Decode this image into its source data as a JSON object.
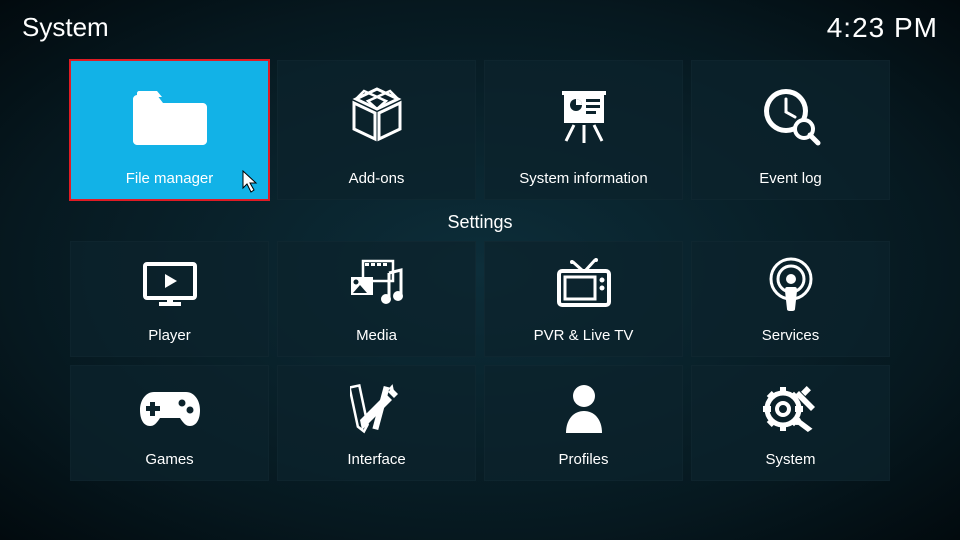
{
  "header": {
    "title": "System",
    "clock": "4:23 PM"
  },
  "section_header": "Settings",
  "row1": [
    {
      "label": "File manager",
      "icon": "folder",
      "selected": true
    },
    {
      "label": "Add-ons",
      "icon": "box"
    },
    {
      "label": "System information",
      "icon": "presentation"
    },
    {
      "label": "Event log",
      "icon": "clock-search"
    }
  ],
  "row2": [
    {
      "label": "Player",
      "icon": "monitor-play"
    },
    {
      "label": "Media",
      "icon": "media-mix"
    },
    {
      "label": "PVR & Live TV",
      "icon": "tv"
    },
    {
      "label": "Services",
      "icon": "podcast"
    }
  ],
  "row3": [
    {
      "label": "Games",
      "icon": "gamepad"
    },
    {
      "label": "Interface",
      "icon": "design-tools"
    },
    {
      "label": "Profiles",
      "icon": "user"
    },
    {
      "label": "System",
      "icon": "gear-tools"
    }
  ]
}
